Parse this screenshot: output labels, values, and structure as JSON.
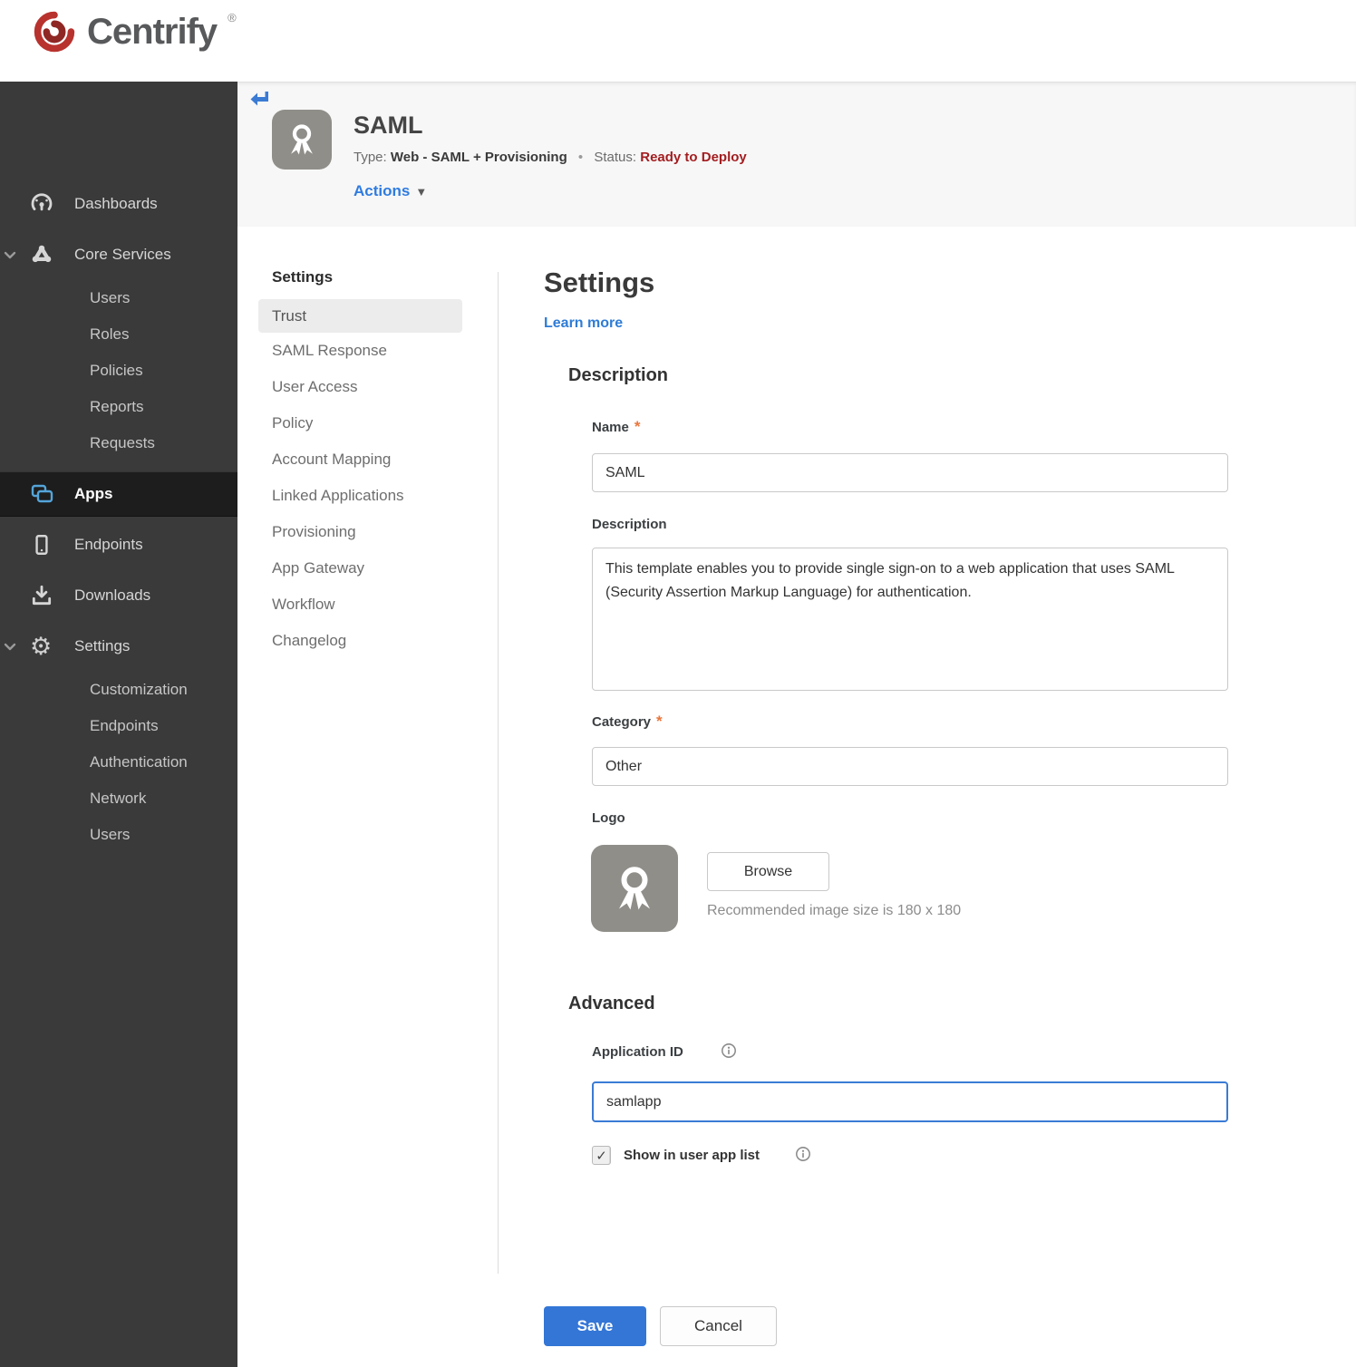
{
  "brand": {
    "name": "Centrify",
    "trademark": "®"
  },
  "icons": {
    "caret_down": "▼",
    "check": "✓",
    "gear": "⚙",
    "separator": "•"
  },
  "misc": {
    "required": "*"
  },
  "sidebar": {
    "items": [
      {
        "label": "Dashboards"
      },
      {
        "label": "Core Services",
        "expanded": true,
        "children": [
          "Users",
          "Roles",
          "Policies",
          "Reports",
          "Requests"
        ]
      },
      {
        "label": "Apps",
        "active": true
      },
      {
        "label": "Endpoints"
      },
      {
        "label": "Downloads"
      },
      {
        "label": "Settings",
        "expanded": true,
        "children": [
          "Customization",
          "Endpoints",
          "Authentication",
          "Network",
          "Users"
        ]
      }
    ]
  },
  "header": {
    "app_name": "SAML",
    "type_label": "Type:",
    "type_value": "Web - SAML + Provisioning",
    "status_label": "Status:",
    "status_value": "Ready to Deploy",
    "actions_label": "Actions"
  },
  "subnav": {
    "title": "Settings",
    "active_item": "Trust",
    "items": [
      "SAML Response",
      "User Access",
      "Policy",
      "Account Mapping",
      "Linked Applications",
      "Provisioning",
      "App Gateway",
      "Workflow",
      "Changelog"
    ]
  },
  "main": {
    "title": "Settings",
    "learn_more": "Learn more",
    "description": {
      "section_title": "Description",
      "name_label": "Name",
      "name_value": "SAML",
      "description_label": "Description",
      "description_value": "This template enables you to provide single sign-on to a web application that uses SAML (Security Assertion Markup Language) for authentication.",
      "category_label": "Category",
      "category_value": "Other",
      "logo_label": "Logo",
      "browse_label": "Browse",
      "logo_hint": "Recommended image size is 180 x 180"
    },
    "advanced": {
      "section_title": "Advanced",
      "application_id_label": "Application ID",
      "application_id_value": "samlapp",
      "show_in_list_label": "Show in user app list",
      "show_in_list_checked": true
    },
    "buttons": {
      "save": "Save",
      "cancel": "Cancel"
    }
  },
  "colors": {
    "accent_blue": "#2f7ce0",
    "save_blue": "#3376d6",
    "status_red": "#a31d20",
    "required_orange": "#e9763d",
    "sidebar_bg": "#3a3a3a",
    "active_row_bg": "#1d1d1d",
    "band_bg": "#f7f7f7",
    "apps_icon_blue": "#54a4d9",
    "logo_gray": "#908e89",
    "focus_border": "#3a7bd5"
  }
}
